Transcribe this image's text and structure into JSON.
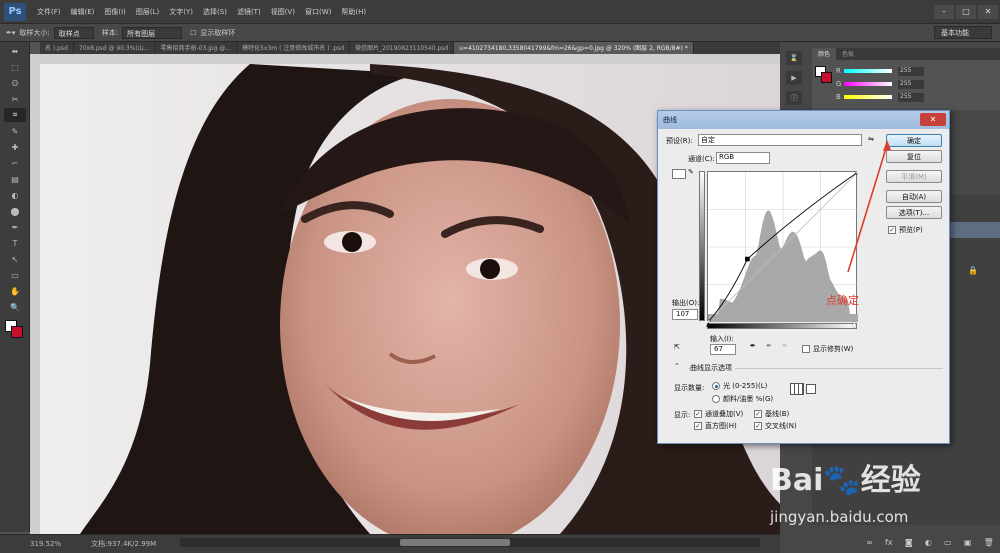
{
  "app": {
    "logo": "Ps"
  },
  "menu": [
    "文件(F)",
    "编辑(E)",
    "图像(I)",
    "图层(L)",
    "文字(Y)",
    "选择(S)",
    "滤镜(T)",
    "视图(V)",
    "窗口(W)",
    "帮助(H)"
  ],
  "window_controls": [
    "–",
    "□",
    "✕"
  ],
  "options": {
    "sample_size_label": "取样大小:",
    "sample_size_value": "取样点",
    "sample_label": "样本:",
    "sample_value": "所有图层",
    "show_ring_label": "显示取样环",
    "workspace": "基本功能"
  },
  "tabs": [
    {
      "label": "名 ).psd",
      "active": false
    },
    {
      "label": "70x8.psd @ 90.3%(山...",
      "active": false
    },
    {
      "label": "零售招商手册-03.jpg @...",
      "active": false
    },
    {
      "label": "模特化5x3m ( 注意修改城市名 ) .psd",
      "active": false
    },
    {
      "label": "微信图片_20190823110540.psd",
      "active": false
    },
    {
      "label": "u=4102734180,3358041799&fm=26&gp=0.jpg @ 320% (图层 2, RGB/8#) *",
      "active": true
    }
  ],
  "tools": [
    "⬌",
    "⬚",
    "ʘ",
    "✂",
    "⌗",
    "✎",
    "✚",
    "⌐",
    "▤",
    "◐",
    "⬤",
    "✒",
    "T",
    "↖",
    "▭",
    "✋",
    "🔍"
  ],
  "status": {
    "zoom": "319.52%",
    "doc": "文档:937.4K/2.99M"
  },
  "panel": {
    "tab_color": "颜色",
    "tab_swatches": "色板",
    "fg_color": "#ffffff",
    "bg_color": "#c8102e",
    "sliders": [
      {
        "label": "R",
        "value": "255",
        "gradient": "linear-gradient(to right,#00ffff,#ffffff)"
      },
      {
        "label": "G",
        "value": "255",
        "gradient": "linear-gradient(to right,#ff00ff,#ffffff)"
      },
      {
        "label": "B",
        "value": "255",
        "gradient": "linear-gradient(to right,#ffff00,#ffffff)"
      }
    ]
  },
  "dialog": {
    "title": "曲线",
    "preset_label": "预设(R):",
    "preset_value": "自定",
    "channel_label": "通道(C):",
    "channel_value": "RGB",
    "buttons": {
      "ok": "确定",
      "reset": "复位",
      "smooth": "平滑(M)",
      "auto": "自动(A)",
      "options": "选项(T)..."
    },
    "preview_label": "预览(P)",
    "preview_checked": true,
    "output_label": "输出(O):",
    "output_value": "107",
    "input_label": "输入(I):",
    "input_value": "67",
    "clip_label": "显示修剪(W)",
    "display_options_label": "曲线显示选项",
    "show_amount_label": "显示数量:",
    "light_label": "光 (0-255)(L)",
    "pigment_label": "颜料/油墨 %(G)",
    "show_label": "显示:",
    "checkboxes": [
      {
        "label": "通道叠加(V)",
        "checked": true
      },
      {
        "label": "基线(B)",
        "checked": true
      },
      {
        "label": "直方图(H)",
        "checked": true
      },
      {
        "label": "交叉线(N)",
        "checked": true
      }
    ],
    "curve_point": {
      "input": 67,
      "output": 107
    }
  },
  "annotation": "点确定",
  "watermark": {
    "text": "Bai🐾经验",
    "url": "jingyan.baidu.com"
  }
}
